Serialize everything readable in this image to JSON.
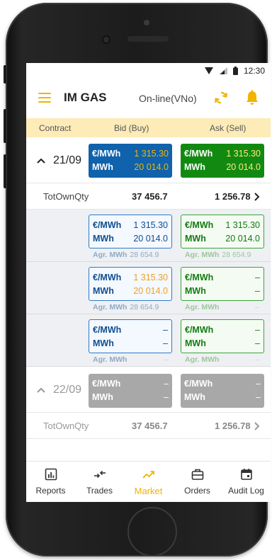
{
  "status_bar": {
    "time": "12:30"
  },
  "app_bar": {
    "title": "IM GAS",
    "connection": "On-line(VNo)"
  },
  "columns": {
    "contract": "Contract",
    "bid": "Bid (Buy)",
    "ask": "Ask (Sell)"
  },
  "units": {
    "price": "€/MWh",
    "qty": "MWh",
    "agr": "Agr. MWh"
  },
  "contracts": [
    {
      "date": "21/09",
      "best_bid": {
        "price": "1 315.30",
        "qty": "20 014.0"
      },
      "best_ask": {
        "price": "1 315.30",
        "qty": "20 014.0"
      },
      "tot": {
        "label": "TotOwnQty",
        "bid": "37 456.7",
        "ask": "1 256.78"
      },
      "depth": [
        {
          "bid_price": "1 315.30",
          "bid_qty": "20 014.0",
          "bid_agr": "28 654.9",
          "ask_price": "1 315.30",
          "ask_qty": "20 014.0",
          "ask_agr": "28 654.9"
        },
        {
          "bid_price": "1 315.30",
          "bid_qty": "20 014.0",
          "bid_agr": "28 654.9",
          "ask_price": "–",
          "ask_qty": "–",
          "ask_agr": "–"
        },
        {
          "bid_price": "–",
          "bid_qty": "–",
          "bid_agr": "–",
          "ask_price": "–",
          "ask_qty": "–",
          "ask_agr": "–"
        }
      ]
    },
    {
      "date": "22/09",
      "best_bid": {
        "price": "–",
        "qty": "–"
      },
      "best_ask": {
        "price": "–",
        "qty": "–"
      },
      "tot": {
        "label": "TotOwnQty",
        "bid": "37 456.7",
        "ask": "1 256.78"
      }
    }
  ],
  "nav": [
    {
      "label": "Reports",
      "icon": "reports-icon"
    },
    {
      "label": "Trades",
      "icon": "trades-icon"
    },
    {
      "label": "Market",
      "icon": "market-icon",
      "active": true
    },
    {
      "label": "Orders",
      "icon": "orders-icon"
    },
    {
      "label": "Audit Log",
      "icon": "audit-log-icon"
    }
  ],
  "colors": {
    "accent": "#f0b400",
    "bid": "#0f62ab",
    "ask": "#128a12",
    "inactive": "#a8a8a8",
    "header_bg": "#fdebb8"
  }
}
